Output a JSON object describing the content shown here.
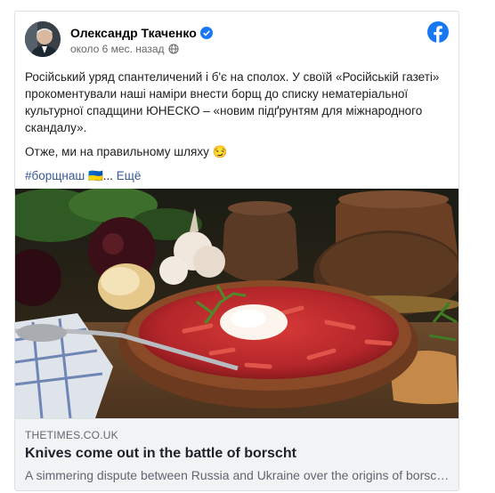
{
  "post": {
    "author": "Олександр Ткаченко",
    "timestamp": "около 6 мес. назад",
    "paragraph1": "Російський уряд спантеличений і б'є на сполох. У своїй «Російській газеті» прокоментували наші наміри внести борщ до списку нематеріальної культурної спадщини ЮНЕСКО – «новим підґрунтям для міжнародного скандалу».",
    "paragraph2": "Отже, ми на правильному шляху 😏",
    "hashtag": "#борщнаш",
    "flag": "🇺🇦",
    "ellipsis": "...",
    "more": "Ещё"
  },
  "link": {
    "domain": "THETIMES.CO.UK",
    "title": "Knives come out in the battle of borscht",
    "description": "A simmering dispute between Russia and Ukraine over the origins of borscht..."
  },
  "icons": {
    "verified": "verified-badge-icon",
    "globe": "globe-icon",
    "facebook": "facebook-logo-icon"
  },
  "colors": {
    "brand": "#1877f2",
    "link": "#385898",
    "borscht": "#b3262a"
  }
}
